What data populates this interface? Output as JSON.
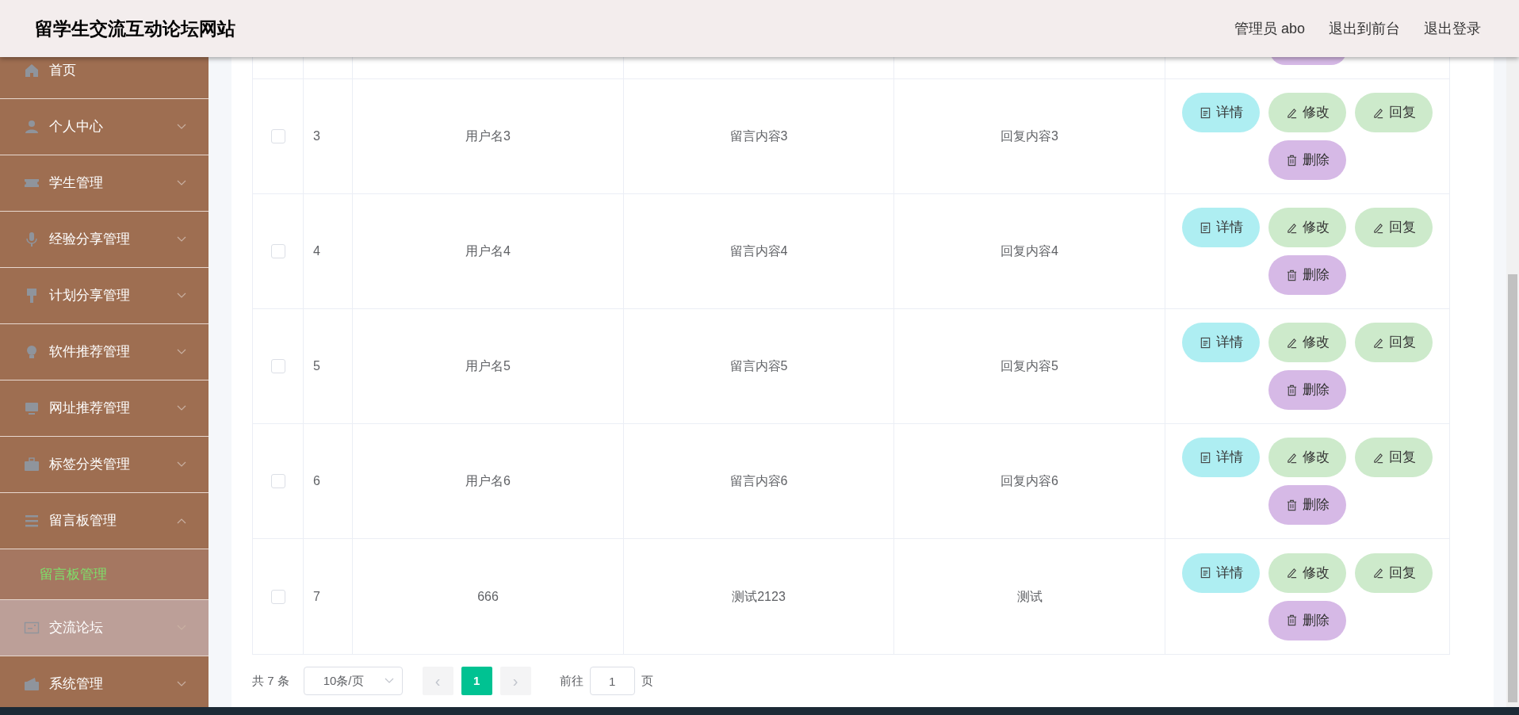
{
  "header": {
    "title": "留学生交流互动论坛网站",
    "user": "管理员 abo",
    "links": [
      "退出到前台",
      "退出登录"
    ]
  },
  "sidebar": {
    "items": [
      {
        "label": "首页",
        "hovered": false
      },
      {
        "label": "个人中心",
        "expanded": false,
        "hovered": false
      },
      {
        "label": "学生管理",
        "expanded": false,
        "hovered": false
      },
      {
        "label": "经验分享管理",
        "expanded": false,
        "hovered": false
      },
      {
        "label": "计划分享管理",
        "expanded": false,
        "hovered": false
      },
      {
        "label": "软件推荐管理",
        "expanded": false,
        "hovered": false
      },
      {
        "label": "网址推荐管理",
        "expanded": false,
        "hovered": false
      },
      {
        "label": "标签分类管理",
        "expanded": false,
        "hovered": false
      },
      {
        "label": "留言板管理",
        "expanded": true,
        "hovered": false,
        "children": [
          {
            "label": "留言板管理",
            "selected": true
          }
        ]
      },
      {
        "label": "交流论坛",
        "expanded": false,
        "hovered": true
      },
      {
        "label": "系统管理",
        "expanded": false,
        "hovered": false
      }
    ]
  },
  "table": {
    "rows": [
      {
        "checked": false,
        "index": "3",
        "username": "用户名3",
        "content": "留言内容3",
        "reply": "回复内容3",
        "actions": [
          {
            "kind": "detail",
            "label": "详情"
          },
          {
            "kind": "edit",
            "label": "修改"
          },
          {
            "kind": "reply",
            "label": "回复"
          },
          {
            "kind": "delete",
            "label": "删除"
          }
        ]
      },
      {
        "checked": false,
        "index": "4",
        "username": "用户名4",
        "content": "留言内容4",
        "reply": "回复内容4",
        "actions": [
          {
            "kind": "detail",
            "label": "详情"
          },
          {
            "kind": "edit",
            "label": "修改"
          },
          {
            "kind": "reply",
            "label": "回复"
          },
          {
            "kind": "delete",
            "label": "删除"
          }
        ]
      },
      {
        "checked": false,
        "index": "5",
        "username": "用户名5",
        "content": "留言内容5",
        "reply": "回复内容5",
        "actions": [
          {
            "kind": "detail",
            "label": "详情"
          },
          {
            "kind": "edit",
            "label": "修改"
          },
          {
            "kind": "reply",
            "label": "回复"
          },
          {
            "kind": "delete",
            "label": "删除"
          }
        ]
      },
      {
        "checked": false,
        "index": "6",
        "username": "用户名6",
        "content": "留言内容6",
        "reply": "回复内容6",
        "actions": [
          {
            "kind": "detail",
            "label": "详情"
          },
          {
            "kind": "edit",
            "label": "修改"
          },
          {
            "kind": "reply",
            "label": "回复"
          },
          {
            "kind": "delete",
            "label": "删除"
          }
        ]
      },
      {
        "checked": false,
        "index": "7",
        "username": "666",
        "content": "测试2123",
        "reply": "测试",
        "actions": [
          {
            "kind": "detail",
            "label": "详情"
          },
          {
            "kind": "edit",
            "label": "修改"
          },
          {
            "kind": "reply",
            "label": "回复"
          },
          {
            "kind": "delete",
            "label": "删除"
          }
        ]
      }
    ]
  },
  "pagination": {
    "total": "共 7 条",
    "page_size": "10条/页",
    "prev": "‹",
    "pages": [
      {
        "label": "1",
        "selected": true
      }
    ],
    "next": "›",
    "goto_label": "前往",
    "goto_value": "1",
    "goto_suffix": "页"
  }
}
